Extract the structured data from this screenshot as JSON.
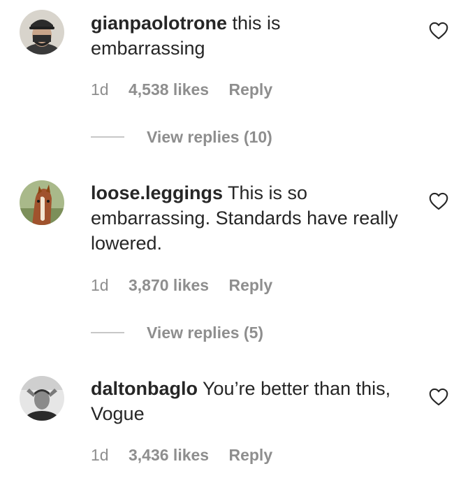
{
  "comments": [
    {
      "username": "gianpaolotrone",
      "text": "this is embarrassing",
      "age": "1d",
      "likes": "4,538 likes",
      "reply": "Reply",
      "view_replies": "View replies (10)",
      "avatar_icon": "profile-photo-masked-man",
      "heart_icon": "heart-outline-icon"
    },
    {
      "username": "loose.leggings",
      "text": "This is so embarrassing. Standards have really lowered.",
      "age": "1d",
      "likes": "3,870 likes",
      "reply": "Reply",
      "view_replies": "View replies (5)",
      "avatar_icon": "profile-photo-horse",
      "heart_icon": "heart-outline-icon"
    },
    {
      "username": "daltonbaglo",
      "text": "You’re better than this, Vogue",
      "age": "1d",
      "likes": "3,436 likes",
      "reply": "Reply",
      "avatar_icon": "profile-photo-man-bw",
      "heart_icon": "heart-outline-icon"
    }
  ]
}
